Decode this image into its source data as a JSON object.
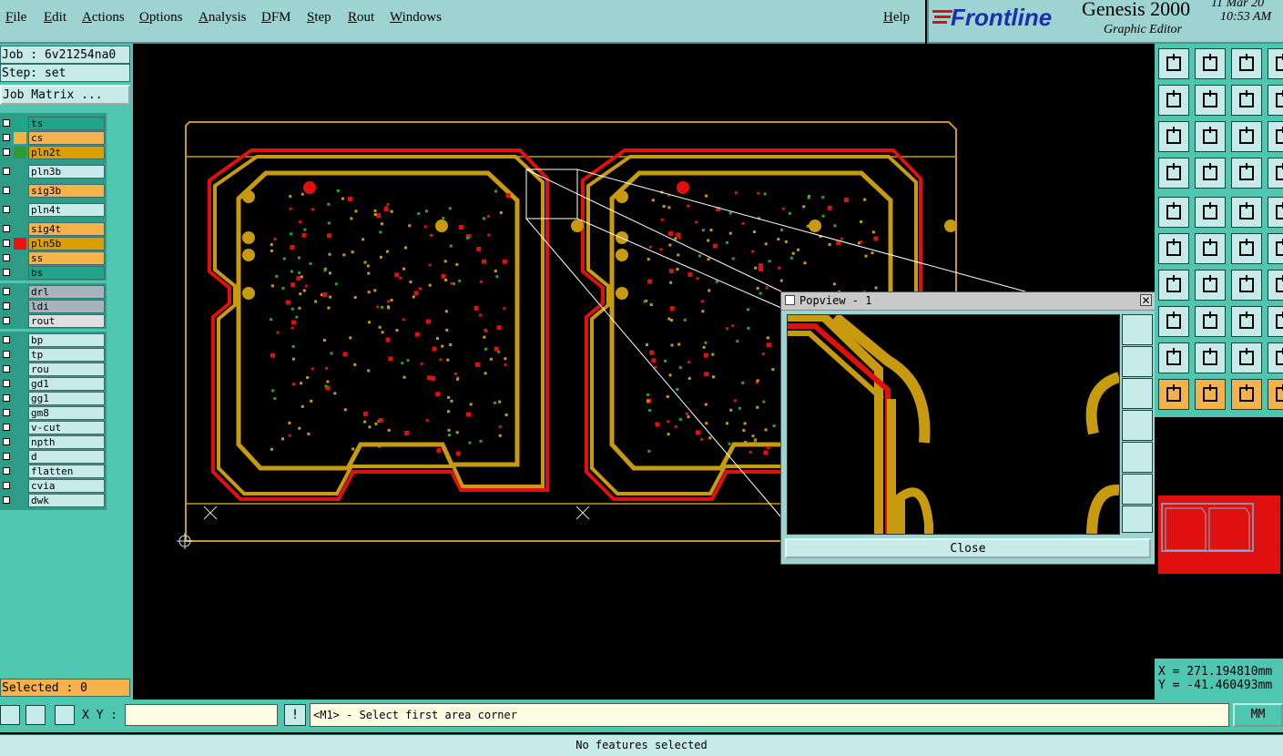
{
  "menu": {
    "items": [
      "File",
      "Edit",
      "Actions",
      "Options",
      "Analysis",
      "DFM",
      "Step",
      "Rout",
      "Windows"
    ],
    "help": "Help"
  },
  "brand": {
    "logo": "Frontline",
    "product": "Genesis 2000",
    "subtitle": "Graphic Editor",
    "date": "11 Mar 20",
    "time": "10:53 AM"
  },
  "left_panel": {
    "job": "Job : 6v21254na0",
    "step": "Step: set",
    "job_matrix_button": "Job Matrix ...",
    "selected": "Selected : 0",
    "layers": [
      {
        "name": "ts",
        "color": "#1fa58a",
        "bg": "#1fa58a"
      },
      {
        "name": "cs",
        "color": "#f5b24a",
        "bg": "#f5b24a"
      },
      {
        "name": "pln2t",
        "color": "#2d9b2d",
        "bg": "#d9a000"
      },
      {
        "name": "pln3b",
        "color": "",
        "bg": "#c6ebe9"
      },
      {
        "name": "sig3b",
        "color": "",
        "bg": "#f5b24a"
      },
      {
        "name": "pln4t",
        "color": "",
        "bg": "#c6ebe9"
      },
      {
        "name": "sig4t",
        "color": "",
        "bg": "#f5b24a"
      },
      {
        "name": "pln5b",
        "color": "#ee1111",
        "bg": "#d9a000"
      },
      {
        "name": "ss",
        "color": "",
        "bg": "#f5b24a"
      },
      {
        "name": "bs",
        "color": "",
        "bg": "#1fa58a"
      },
      {
        "name": "drl",
        "color": "",
        "bg": "#a8b4bb"
      },
      {
        "name": "ldi",
        "color": "",
        "bg": "#a8b4bb"
      },
      {
        "name": "rout",
        "color": "",
        "bg": "#dfdfdf"
      },
      {
        "name": "bp",
        "color": "",
        "bg": "#c6ebe9"
      },
      {
        "name": "tp",
        "color": "",
        "bg": "#c6ebe9"
      },
      {
        "name": "rou",
        "color": "",
        "bg": "#c6ebe9"
      },
      {
        "name": "gd1",
        "color": "",
        "bg": "#c6ebe9"
      },
      {
        "name": "gg1",
        "color": "",
        "bg": "#c6ebe9"
      },
      {
        "name": "gm8",
        "color": "",
        "bg": "#c6ebe9"
      },
      {
        "name": "v-cut",
        "color": "",
        "bg": "#c6ebe9"
      },
      {
        "name": "npth",
        "color": "",
        "bg": "#c6ebe9"
      },
      {
        "name": "d",
        "color": "",
        "bg": "#c6ebe9"
      },
      {
        "name": "flatten",
        "color": "",
        "bg": "#c6ebe9"
      },
      {
        "name": "cvia",
        "color": "",
        "bg": "#c6ebe9"
      },
      {
        "name": "dwk",
        "color": "",
        "bg": "#c6ebe9"
      }
    ]
  },
  "popview": {
    "title": "Popview - 1",
    "close_button": "Close"
  },
  "coords": {
    "x": "X = 271.194810mm",
    "y": "Y = -41.460493mm"
  },
  "bottom": {
    "xy_label": "X Y :",
    "xy_value": "",
    "prompt": "<M1> - Select first area corner",
    "units": "MM",
    "status": "No features selected"
  },
  "colors": {
    "panel": "#4ec6b0",
    "menu": "#9dd4d2",
    "copper": "#c89a10",
    "trace_red": "#e01010",
    "pad_green": "#2fa02f"
  }
}
